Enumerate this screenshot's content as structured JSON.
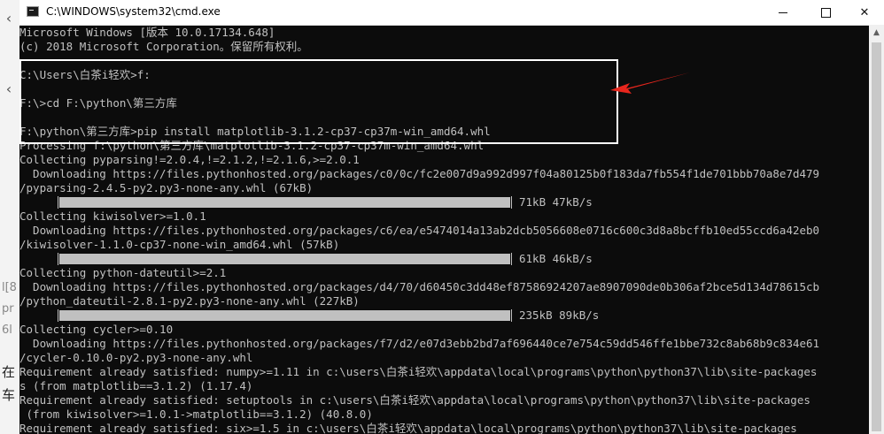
{
  "window": {
    "title": "C:\\WINDOWS\\system32\\cmd.exe",
    "controls": {
      "minimize": "minimize",
      "maximize": "maximize",
      "close": "close"
    }
  },
  "background_app": {
    "fragments": [
      "l[8",
      "pr",
      "6l",
      "在",
      "车"
    ]
  },
  "console": {
    "lines": [
      "Microsoft Windows [版本 10.0.17134.648]",
      "(c) 2018 Microsoft Corporation。保留所有权利。",
      "",
      "C:\\Users\\白茶i轻欢>f:",
      "",
      "F:\\>cd F:\\python\\第三方库",
      "",
      "F:\\python\\第三方库>pip install matplotlib-3.1.2-cp37-cp37m-win_amd64.whl",
      "Processing f:\\python\\第三方库\\matplotlib-3.1.2-cp37-cp37m-win_amd64.whl",
      "Collecting pyparsing!=2.0.4,!=2.1.2,!=2.1.6,>=2.0.1",
      "  Downloading https://files.pythonhosted.org/packages/c0/0c/fc2e007d9a992d997f04a80125b0f183da7fb554f1de701bbb70a8e7d479",
      "/pyparsing-2.4.5-py2.py3-none-any.whl (67kB)",
      "",
      "Collecting kiwisolver>=1.0.1",
      "  Downloading https://files.pythonhosted.org/packages/c6/ea/e5474014a13ab2dcb5056608e0716c600c3d8a8bcffb10ed55ccd6a42eb0",
      "/kiwisolver-1.1.0-cp37-none-win_amd64.whl (57kB)",
      "",
      "Collecting python-dateutil>=2.1",
      "  Downloading https://files.pythonhosted.org/packages/d4/70/d60450c3dd48ef87586924207ae8907090de0b306af2bce5d134d78615cb",
      "/python_dateutil-2.8.1-py2.py3-none-any.whl (227kB)",
      "",
      "Collecting cycler>=0.10",
      "  Downloading https://files.pythonhosted.org/packages/f7/d2/e07d3ebb2bd7af696440ce7e754c59dd546ffe1bbe732c8ab68b9c834e61",
      "/cycler-0.10.0-py2.py3-none-any.whl",
      "Requirement already satisfied: numpy>=1.11 in c:\\users\\白茶i轻欢\\appdata\\local\\programs\\python\\python37\\lib\\site-packages",
      "s (from matplotlib==3.1.2) (1.17.4)",
      "Requirement already satisfied: setuptools in c:\\users\\白茶i轻欢\\appdata\\local\\programs\\python\\python37\\lib\\site-packages",
      " (from kiwisolver>=1.0.1->matplotlib==3.1.2) (40.8.0)",
      "Requirement already satisfied: six>=1.5 in c:\\users\\白茶i轻欢\\appdata\\local\\programs\\python\\python37\\lib\\site-packages"
    ],
    "progress_bars": [
      {
        "line_index": 12,
        "text": "71kB 47kB/s",
        "fraction": 1.0
      },
      {
        "line_index": 16,
        "text": "61kB 46kB/s",
        "fraction": 1.0
      },
      {
        "line_index": 20,
        "text": "235kB 89kB/s",
        "fraction": 1.0
      }
    ]
  },
  "annotation": {
    "highlight_color": "#ffffff",
    "arrow_color": "#e8261d"
  },
  "colors": {
    "console_bg": "#0c0c0c",
    "console_text": "#c0c0c0"
  }
}
